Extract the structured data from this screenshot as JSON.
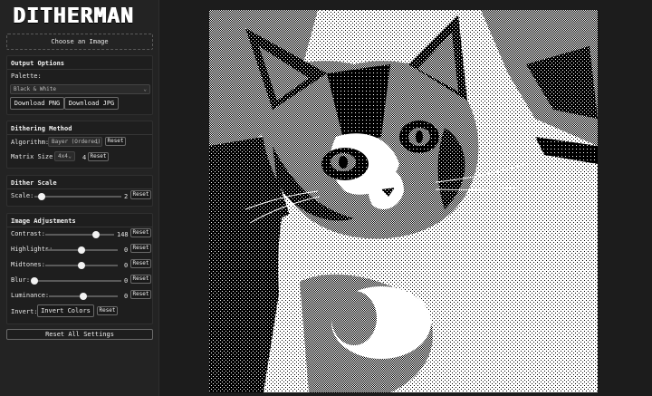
{
  "app": {
    "title": "DITHERMAN"
  },
  "upload": {
    "label": "Choose an Image"
  },
  "output": {
    "title": "Output Options",
    "palette_label": "Palette:",
    "palette_value": "Black & White",
    "download_png": "Download PNG",
    "download_jpg": "Download JPG"
  },
  "method": {
    "title": "Dithering Method",
    "algorithm_label": "Algorithm:",
    "algorithm_value": "Bayer (Ordered)",
    "matrix_label": "Matrix Size:",
    "matrix_value": "4x4",
    "matrix_number": "4",
    "reset": "Reset"
  },
  "scale": {
    "title": "Dither Scale",
    "label": "Scale:",
    "value": "2",
    "level": 0.08,
    "reset": "Reset"
  },
  "adjust": {
    "title": "Image Adjustments",
    "sliders": [
      {
        "label": "Contrast:",
        "value": "148",
        "level": 0.74,
        "reset": "Reset"
      },
      {
        "label": "Highlights:",
        "value": "0",
        "level": 0.5,
        "reset": "Reset"
      },
      {
        "label": "Midtones:",
        "value": "0",
        "level": 0.5,
        "reset": "Reset"
      },
      {
        "label": "Blur:",
        "value": "0",
        "level": 0.0,
        "reset": "Reset"
      },
      {
        "label": "Luminance:",
        "value": "0",
        "level": 0.5,
        "reset": "Reset"
      }
    ],
    "invert_label": "Invert:",
    "invert_button": "Invert Colors",
    "invert_reset": "Reset"
  },
  "reset_all": "Reset All Settings",
  "image": {
    "subject": "kitten"
  },
  "colors": {
    "background": "#1c1c1c",
    "panel": "#232323",
    "accent": "#f2f2f2"
  }
}
